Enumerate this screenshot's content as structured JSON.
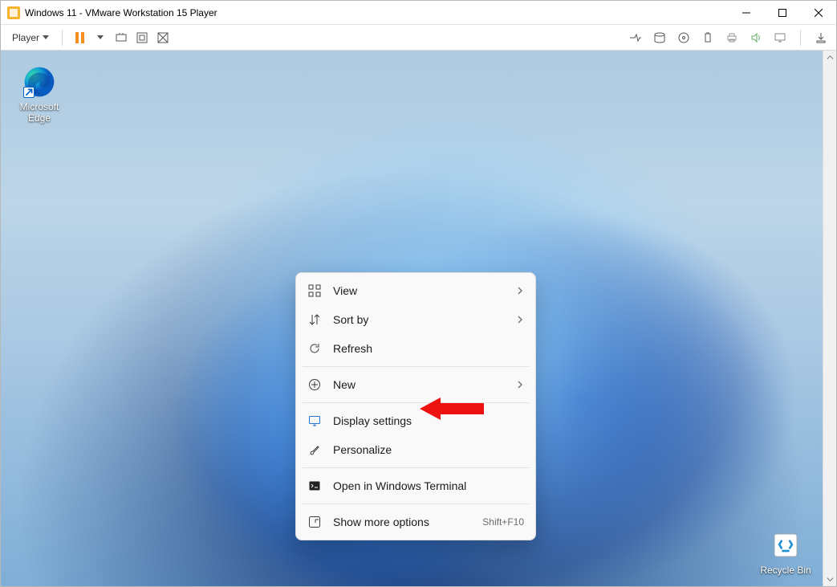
{
  "titlebar": {
    "title": "Windows 11 - VMware Workstation 15 Player"
  },
  "toolbar": {
    "player_menu_label": "Player"
  },
  "desktop": {
    "icons": {
      "edge_label": "Microsoft Edge",
      "recycle_label": "Recycle Bin"
    }
  },
  "context_menu": {
    "items": [
      {
        "label": "View",
        "has_submenu": true
      },
      {
        "label": "Sort by",
        "has_submenu": true
      },
      {
        "label": "Refresh",
        "has_submenu": false
      }
    ],
    "group2": [
      {
        "label": "New",
        "has_submenu": true
      }
    ],
    "group3": [
      {
        "label": "Display settings",
        "has_submenu": false
      },
      {
        "label": "Personalize",
        "has_submenu": false
      }
    ],
    "group4": [
      {
        "label": "Open in Windows Terminal",
        "has_submenu": false
      }
    ],
    "group5": [
      {
        "label": "Show more options",
        "has_submenu": false,
        "shortcut": "Shift+F10"
      }
    ]
  }
}
